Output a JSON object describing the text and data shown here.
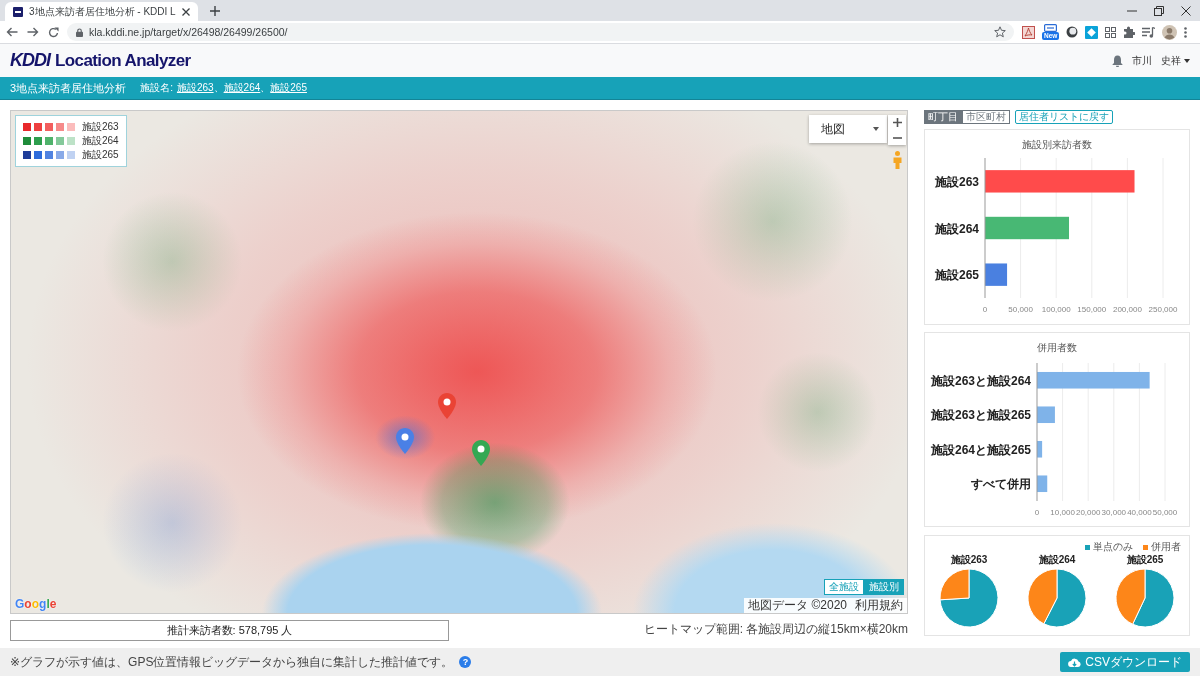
{
  "browser": {
    "tab_title": "3地点来訪者居住地分析 - KDDI L",
    "url": "kla.kddi.ne.jp/target/x/26498/26499/26500/",
    "extension_badge": "New"
  },
  "header": {
    "logo_mark": "KDDI",
    "logo_text": "Location Analyzer",
    "user_family_name": "市川",
    "user_given_name": "史祥"
  },
  "title_bar": {
    "title": "3地点来訪者居住地分析",
    "facilities_label": "施設名:",
    "separator": "、",
    "facilities": [
      {
        "label": "施設263"
      },
      {
        "label": "施設264"
      },
      {
        "label": "施設265"
      }
    ]
  },
  "map": {
    "legend": [
      {
        "label": "施設263",
        "shades": [
          {
            "color": "#e8282b"
          },
          {
            "color": "#ee4040"
          },
          {
            "color": "#f25e5e"
          },
          {
            "color": "#f68a8a"
          },
          {
            "color": "#fbbcbc"
          }
        ]
      },
      {
        "label": "施設264",
        "shades": [
          {
            "color": "#1e8c3a"
          },
          {
            "color": "#2d9e4d"
          },
          {
            "color": "#4fb26b"
          },
          {
            "color": "#84c99a"
          },
          {
            "color": "#bde2c7"
          }
        ]
      },
      {
        "label": "施設265",
        "shades": [
          {
            "color": "#1f3d99"
          },
          {
            "color": "#2e6cdb"
          },
          {
            "color": "#5183e0"
          },
          {
            "color": "#89aae8"
          },
          {
            "color": "#c0d2f2"
          }
        ]
      }
    ],
    "map_type": "地図",
    "markers": [
      {
        "color": "#ea4335"
      },
      {
        "color": "#4a80e6"
      },
      {
        "color": "#34a853"
      }
    ],
    "provider": "Google",
    "attribution": "地図データ ©2020",
    "terms": "利用規約",
    "view_toggle": [
      {
        "label": "全施設",
        "selected": false
      },
      {
        "label": "施設別",
        "selected": true
      }
    ]
  },
  "estimate": "推計来訪者数: 578,795 人",
  "heatmap_range": "ヒートマップ範囲: 各施設周辺の縦15km×横20km",
  "side_panel": {
    "area_toggle": [
      {
        "label": "町丁目",
        "selected": true
      },
      {
        "label": "市区町村",
        "selected": false
      }
    ],
    "back_button": "居住者リストに戻す",
    "visitors_chart": {
      "chart_data": {
        "type": "bar",
        "orientation": "horizontal",
        "grid": true,
        "title": "施設別来訪者数",
        "categories": [
          "施設263",
          "施設264",
          "施設265"
        ],
        "values": [
          210000,
          118000,
          31000
        ],
        "colors": [
          "#ff4b4b",
          "#48b874",
          "#4a80e0"
        ],
        "xlim": [
          0,
          250000
        ],
        "xticks": [
          0,
          {
            "value": 50000,
            "label": "50,000"
          },
          {
            "value": 100000,
            "label": "100,000"
          },
          {
            "value": 150000,
            "label": "150,000"
          },
          {
            "value": 200000,
            "label": "200,000"
          },
          {
            "value": 250000,
            "label": "250,000"
          }
        ]
      }
    },
    "overlap_chart": {
      "chart_data": {
        "type": "bar",
        "orientation": "horizontal",
        "grid": true,
        "title": "併用者数",
        "categories": [
          "施設263と施設264",
          "施設263と施設265",
          "施設264と施設265",
          "すべて併用"
        ],
        "series": [
          {
            "color": "#7fb3e9",
            "values": [
              44000,
              7000,
              2000,
              4000
            ]
          }
        ],
        "xlim": [
          0,
          50000
        ],
        "xticks": [
          0,
          {
            "value": 10000,
            "label": "10,000"
          },
          {
            "value": 20000,
            "label": "20,000"
          },
          {
            "value": 30000,
            "label": "30,000"
          },
          {
            "value": 40000,
            "label": "40,000"
          },
          {
            "value": 50000,
            "label": "50,000"
          }
        ]
      }
    },
    "share_charts": {
      "legend": [
        {
          "label": "単点のみ",
          "color": "#19a2b7"
        },
        {
          "label": "併用者",
          "color": "#fd8619"
        }
      ],
      "charts": [
        {
          "chart_data": {
            "type": "pie",
            "title": "施設263",
            "values": [
              0.74,
              0.26
            ]
          }
        },
        {
          "chart_data": {
            "type": "pie",
            "title": "施設264",
            "values": [
              0.575,
              0.425
            ]
          }
        },
        {
          "chart_data": {
            "type": "pie",
            "title": "施設265",
            "values": [
              0.57,
              0.43
            ]
          }
        }
      ]
    }
  },
  "footer": {
    "note": "※グラフが示す値は、GPS位置情報ビッグデータから独自に集計した推計値です。",
    "help": "?",
    "csv_button": "CSVダウンロード"
  }
}
